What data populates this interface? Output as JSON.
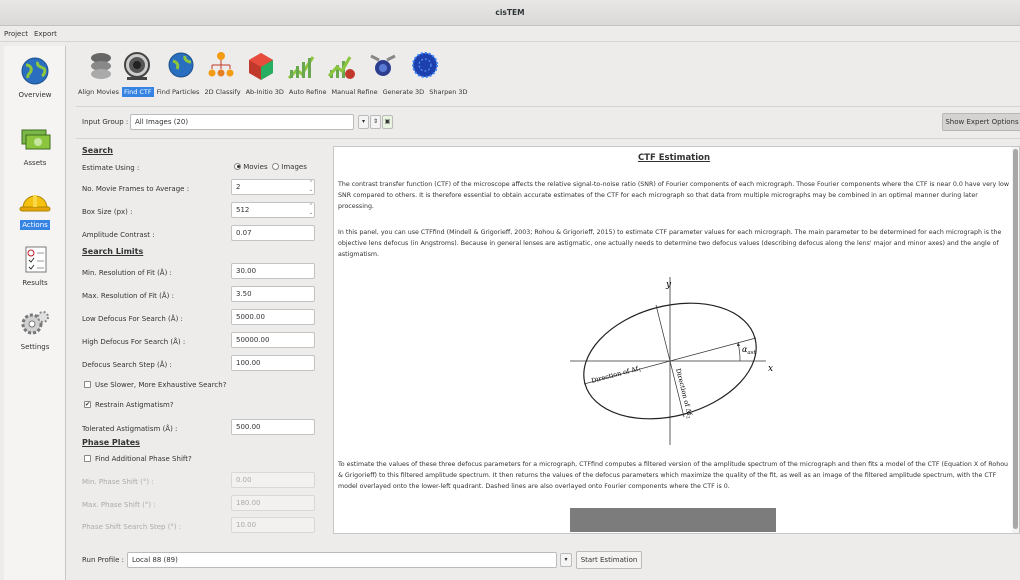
{
  "window": {
    "title": "cisTEM"
  },
  "menu": {
    "items": [
      "Project",
      "Export"
    ]
  },
  "sidebar": {
    "items": [
      {
        "label": "Overview",
        "icon": "globe-icon"
      },
      {
        "label": "Assets",
        "icon": "money-icon"
      },
      {
        "label": "Actions",
        "icon": "hardhat-icon",
        "active": true
      },
      {
        "label": "Results",
        "icon": "checklist-icon"
      },
      {
        "label": "Settings",
        "icon": "gears-icon"
      }
    ]
  },
  "toolbar": {
    "items": [
      {
        "label": "Align Movies",
        "icon": "align-movies-icon"
      },
      {
        "label": "Find CTF",
        "icon": "find-ctf-icon",
        "active": true
      },
      {
        "label": "Find Particles",
        "icon": "find-particles-icon"
      },
      {
        "label": "2D Classify",
        "icon": "classify-2d-icon"
      },
      {
        "label": "Ab-Initio 3D",
        "icon": "ab-initio-icon"
      },
      {
        "label": "Auto Refine",
        "icon": "auto-refine-icon"
      },
      {
        "label": "Manual Refine",
        "icon": "manual-refine-icon"
      },
      {
        "label": "Generate 3D",
        "icon": "generate-3d-icon"
      },
      {
        "label": "Sharpen 3D",
        "icon": "sharpen-3d-icon"
      }
    ]
  },
  "input_group": {
    "label": "Input Group :",
    "value": "All Images (20)",
    "expert_button": "Show Expert Options"
  },
  "form": {
    "search_heading": "Search",
    "estimate_using_label": "Estimate Using :",
    "estimate_options": [
      "Movies",
      "Images"
    ],
    "movie_frames_label": "No. Movie Frames to Average :",
    "movie_frames_value": "2",
    "box_size_label": "Box Size (px) :",
    "box_size_value": "512",
    "amp_contrast_label": "Amplitude Contrast :",
    "amp_contrast_value": "0.07",
    "limits_heading": "Search Limits",
    "min_res_label": "Min. Resolution of Fit (Å) :",
    "min_res_value": "30.00",
    "max_res_label": "Max. Resolution of Fit (Å) :",
    "max_res_value": "3.50",
    "low_def_label": "Low Defocus For Search (Å) :",
    "low_def_value": "5000.00",
    "high_def_label": "High Defocus For Search (Å) :",
    "high_def_value": "50000.00",
    "def_step_label": "Defocus Search Step (Å) :",
    "def_step_value": "100.00",
    "slower_label": "Use Slower, More Exhaustive Search?",
    "slower_checked": false,
    "restrain_label": "Restrain Astigmatism?",
    "restrain_checked": true,
    "tol_astig_label": "Tolerated Astigmatism (Å) :",
    "tol_astig_value": "500.00",
    "phase_heading": "Phase Plates",
    "find_phase_label": "Find Additional Phase Shift?",
    "min_phase_label": "Min. Phase Shift (°) :",
    "min_phase_value": "0.00",
    "max_phase_label": "Max. Phase Shift (°) :",
    "max_phase_value": "180.00",
    "phase_step_label": "Phase Shift Search Step (°) :",
    "phase_step_value": "10.00"
  },
  "panel": {
    "title": "CTF Estimation",
    "para1": "The contrast transfer function (CTF) of the microscope affects the relative signal-to-noise ratio (SNR) of Fourier components of each micrograph. Those Fourier components where the CTF is near 0.0 have very low SNR compared to others. It is therefore essential to obtain accurate estimates of the CTF for each micrograph so that  data from multiple micrographs may be combined in an optimal manner during later processing.",
    "para2": "In this panel, you can use CTFfind (Mindell & Grigorieff, 2003; Rohou & Grigorieff, 2015) to estimate CTF parameter values for each micrograph. The main parameter to be determined for each micrograph is the objective lens defocus (in Angstroms). Because in general lenses are astigmatic, one actually needs to determine two defocus values (describing defocus along the lens' major and minor axes) and the angle of astigmatism.",
    "para3": "To estimate the values of these three defocus parameters for a micrograph, CTFfind computes a filtered version of the amplitude spectrum of the micrograph and then fits a model of the CTF (Equation X of Rohou & Grigorieff) to this filtered amplitude spectrum. It then returns the values of the defocus parameters which maximize the quality of the fit, as well as an image of the filtered amplitude spectrum, with the CTF model overlayed onto the lower-left quadrant. Dashed lines are also overlayed onto Fourier components where the CTF is 0.",
    "diagram": {
      "y_label": "y",
      "x_label": "x",
      "angle_label": "α",
      "angle_sub": "ast",
      "dir1_label": "Direction of Δf",
      "dir1_sub": "1",
      "dir2_label": "Direction of Δf",
      "dir2_sub": "2"
    }
  },
  "run": {
    "label": "Run Profile :",
    "value": "Local 88 (89)",
    "start_button": "Start Estimation"
  }
}
